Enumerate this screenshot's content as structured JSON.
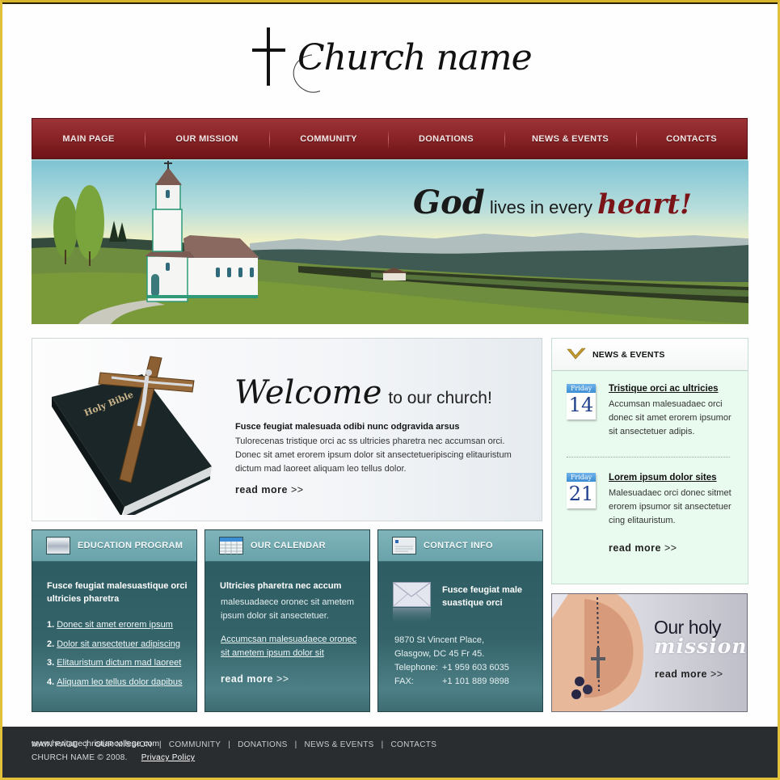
{
  "brand": {
    "logo_text": "Church name"
  },
  "nav": {
    "items": [
      {
        "label": "MAIN PAGE"
      },
      {
        "label": "OUR MISSION"
      },
      {
        "label": "COMMUNITY"
      },
      {
        "label": "DONATIONS"
      },
      {
        "label": "NEWS & EVENTS"
      },
      {
        "label": "CONTACTS"
      }
    ]
  },
  "banner": {
    "slogan_word1": "God",
    "slogan_middle": "lives in every",
    "slogan_word2": "heart",
    "slogan_end": "!"
  },
  "welcome": {
    "title_big": "Welcome",
    "title_small": "to our church!",
    "lead": "Fusce feugiat malesuada odibi nunc odgravida arsus",
    "body": "Tulorecenas tristique orci ac ss ultricies pharetra nec accumsan orci. Donec sit amet erorem ipsum dolor sit ansectetueripiscing elitauristum dictum mad laoreet aliquam leo tellus dolor.",
    "read_more": "read more",
    "read_more_arrow": ">>",
    "image_caption": "Holy Bible"
  },
  "news": {
    "title": "NEWS & EVENTS",
    "items": [
      {
        "day": "Friday",
        "date": "14",
        "title": "Tristique orci ac ultricies",
        "text": "Accumsan malesuadaec orci donec sit amet erorem ipsumor sit ansectetuer adipis."
      },
      {
        "day": "Friday",
        "date": "21",
        "title": "Lorem ipsum dolor sites",
        "text": "Malesuadaec orci donec sitmet erorem ipsumor sit ansectetuer cing elitauristum."
      }
    ],
    "read_more": "read more",
    "read_more_arrow": ">>"
  },
  "mission": {
    "line1": "Our holy",
    "line2": "mission",
    "read_more": "read more",
    "read_more_arrow": ">>"
  },
  "education": {
    "title": "EDUCATION PROGRAM",
    "heading": "Fusce feugiat malesuastique orci ultricies pharetra",
    "items": [
      {
        "num": "1.",
        "text": "Donec sit amet erorem ipsum"
      },
      {
        "num": "2.",
        "text": "Dolor sit ansectetuer adipiscing"
      },
      {
        "num": "3.",
        "text": "Elitauristum dictum mad laoreet"
      },
      {
        "num": "4.",
        "text": "Aliquam leo tellus dolor dapibus"
      }
    ]
  },
  "calendar": {
    "title": "OUR CALENDAR",
    "heading": "Ultricies pharetra nec accum",
    "text": "malesuadaece oronec sit ametem ipsum dolor sit ansectetuer.",
    "link": "Accumcsan malesuadaece oronec sit ametem ipsum dolor sit",
    "read_more": "read more",
    "read_more_arrow": ">>"
  },
  "contact": {
    "title": "CONTACT INFO",
    "heading": "Fusce feugiat male suastique orci",
    "address1": "9870 St Vincent Place,",
    "address2": "Glasgow, DC 45 Fr 45.",
    "phone_label": "Telephone:",
    "phone": "+1 959 603 6035",
    "fax_label": "FAX:",
    "fax": "+1 101 889 9898"
  },
  "footer": {
    "links": [
      "MAIN PAGE",
      "OUR MISSION",
      "COMMUNITY",
      "DONATIONS",
      "NEWS & EVENTS",
      "CONTACTS"
    ],
    "separator": "|",
    "watermark": "www.heritagechristiancollege.com",
    "copyright": "CHURCH NAME  ©  2008.",
    "privacy": "Privacy Policy"
  },
  "colors": {
    "nav_red": "#8a2428",
    "frame_gold": "#e1c13a",
    "box_teal": "#2b5a60",
    "footer_dark": "#2a2d30",
    "news_bg": "#e9faef"
  }
}
